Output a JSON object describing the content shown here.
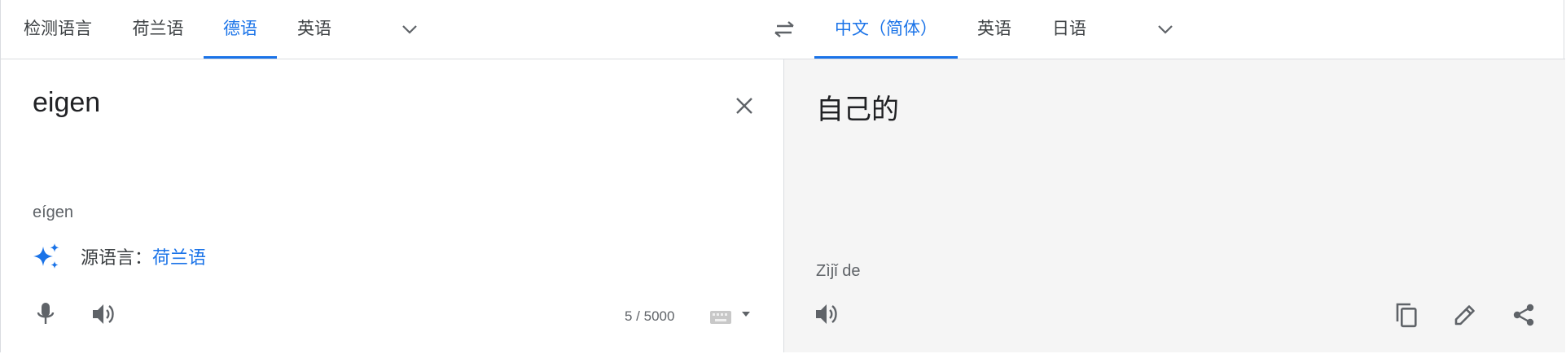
{
  "source_langs": {
    "detect": "检测语言",
    "dutch": "荷兰语",
    "german": "德语",
    "english": "英语"
  },
  "target_langs": {
    "chinese": "中文（简体）",
    "english": "英语",
    "japanese": "日语"
  },
  "source": {
    "text": "eigen",
    "transliteration": "eígen",
    "source_language_prefix": "源语言：",
    "source_language_link": "荷兰语",
    "char_count": "5 / 5000"
  },
  "target": {
    "text": "自己的",
    "romanization": "Zìjǐ de"
  },
  "colors": {
    "accent": "#1a73e8",
    "target_bg": "#f5f5f5",
    "icon": "#5f6368"
  }
}
